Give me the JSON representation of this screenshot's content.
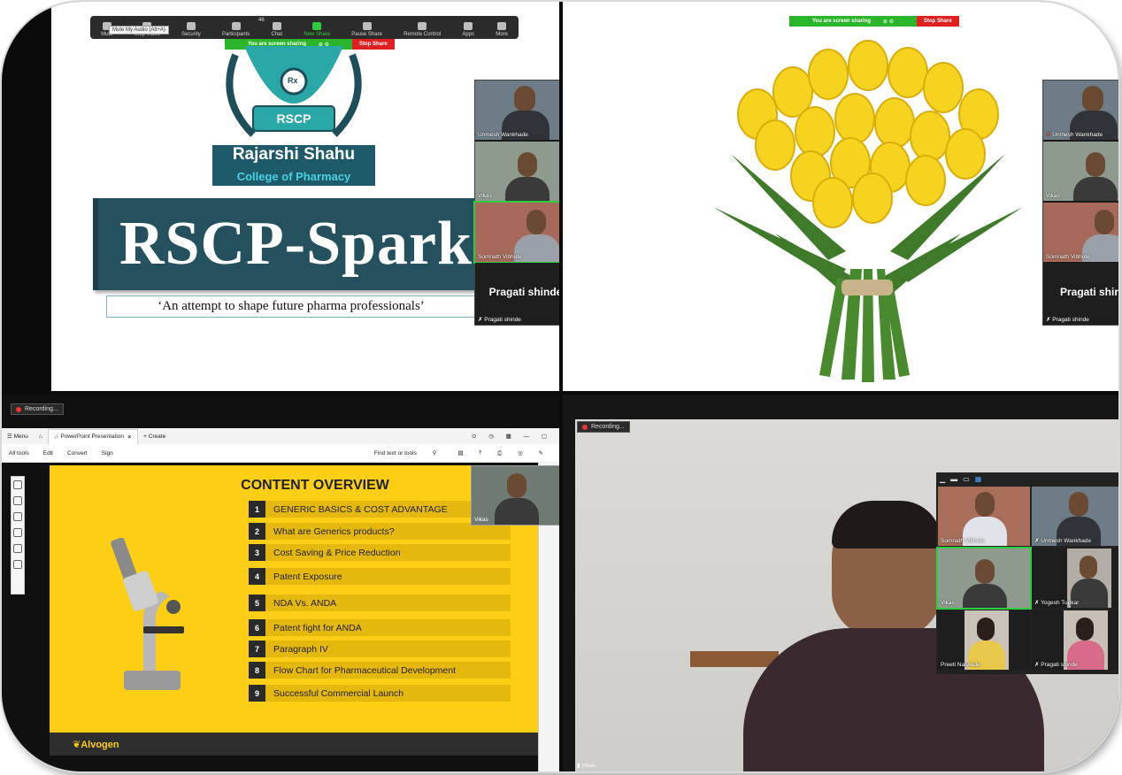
{
  "top_left": {
    "toolbar": {
      "items": [
        "Mute",
        "Stop Video",
        "Security",
        "Participants",
        "Chat",
        "New Share",
        "Pause Share",
        "Remote Control",
        "Apps",
        "More"
      ],
      "participants_count": "46",
      "tooltip": "Mute My Audio (Alt+A)"
    },
    "share_bar": {
      "status": "You are screen sharing",
      "stop": "Stop Share"
    },
    "logo": {
      "abbr": "RSCP",
      "rx": "Rx",
      "name_line1": "Rajarshi Shahu",
      "name_line2": "College of Pharmacy"
    },
    "banner_title": "RSCP-Spark",
    "tagline": "‘An attempt to shape future pharma professionals’",
    "participants": [
      {
        "name": "Unmesh Wankhade"
      },
      {
        "name": "Vikas"
      },
      {
        "name": "Somnath Vibhute"
      }
    ],
    "active_speaker": {
      "big_name": "Pragati shinde",
      "label": "Pragati shinde"
    }
  },
  "top_right": {
    "share_bar": {
      "status": "You are screen sharing",
      "stop": "Stop Share"
    },
    "participants": [
      {
        "name": "Unmesh Wankhade"
      },
      {
        "name": "Vikas"
      },
      {
        "name": "Somnath Vibhute"
      }
    ],
    "active_speaker": {
      "big_name": "Pragati shind",
      "label": "Pragati shinde"
    }
  },
  "bottom_left": {
    "recording": "Recording...",
    "tabs": {
      "menu": "Menu",
      "doc_tab": "PowerPoint Presentation",
      "create": "Create"
    },
    "menu_items": [
      "All tools",
      "Edit",
      "Convert",
      "Sign"
    ],
    "find_placeholder": "Find text or tools",
    "thumb_name": "Vikas",
    "slide": {
      "title": "CONTENT OVERVIEW",
      "items": [
        {
          "num": "1",
          "text": "GENERIC BASICS & COST ADVANTAGE"
        },
        {
          "num": "2",
          "text": "What are Generics products?"
        },
        {
          "num": "3",
          "text": "Cost Saving & Price Reduction"
        },
        {
          "num": "4",
          "text": "Patent Exposure"
        },
        {
          "num": "5",
          "text": "NDA Vs. ANDA"
        },
        {
          "num": "6",
          "text": "Patent fight for ANDA"
        },
        {
          "num": "7",
          "text": "Paragraph IV"
        },
        {
          "num": "8",
          "text": "Flow Chart for Pharmaceutical Development"
        },
        {
          "num": "9",
          "text": "Successful Commercial Launch"
        }
      ],
      "brand": "Alvogen"
    }
  },
  "bottom_right": {
    "recording": "Recording...",
    "gallery": [
      {
        "name": "Somnath Vibhute"
      },
      {
        "name": "Unmesh Wankhade"
      },
      {
        "name": "Vikas"
      },
      {
        "name": "Yogesh Tupkar"
      },
      {
        "name": "Preeti Narwade"
      },
      {
        "name": "Pragati shinde"
      }
    ],
    "main_label": "Vikas"
  }
}
